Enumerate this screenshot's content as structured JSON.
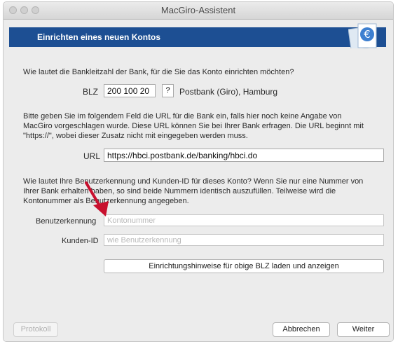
{
  "window": {
    "title": "MacGiro-Assistent"
  },
  "header": {
    "title": "Einrichten eines neuen Kontos"
  },
  "blz_section": {
    "question": "Wie lautet die Bankleitzahl der Bank, für die Sie das Konto einrichten möchten?",
    "label": "BLZ",
    "value": "200 100 20",
    "help_button": "?",
    "bank_name": "Postbank (Giro), Hamburg"
  },
  "url_section": {
    "info_lines": [
      "Bitte geben Sie im folgendem Feld die URL für die Bank ein, falls hier noch keine Angabe von",
      "MacGiro vorgeschlagen wurde. Diese URL können Sie bei Ihrer Bank erfragen. Die URL beginnt mit",
      "\"https://\", wobei dieser Zusatz nicht mit eingegeben werden muss."
    ],
    "label": "URL",
    "value": "https://hbci.postbank.de/banking/hbci.do"
  },
  "user_section": {
    "info_lines": [
      "Wie lautet Ihre Benutzerkennung und Kunden-ID für dieses Konto? Wenn Sie nur eine Nummer von",
      "Ihrer Bank erhalten haben, so sind beide Nummern identisch auszufüllen. Teilweise wird die",
      "Kontonummer als Benutzerkennung angegeben."
    ],
    "user_label": "Benutzerkennung",
    "user_placeholder": "Kontonummer",
    "customer_label": "Kunden-ID",
    "customer_placeholder": "wie Benutzerkennung",
    "load_button": "Einrichtungshinweise für obige BLZ laden und anzeigen"
  },
  "footer": {
    "protocol_button": "Protokoll",
    "cancel_button": "Abbrechen",
    "next_button": "Weiter"
  },
  "colors": {
    "header_blue": "#1d4f93",
    "annotation_arrow": "#c8102e"
  },
  "icons": {
    "logo": "macgiro-logo-icon",
    "annotation": "red-arrow-icon"
  }
}
